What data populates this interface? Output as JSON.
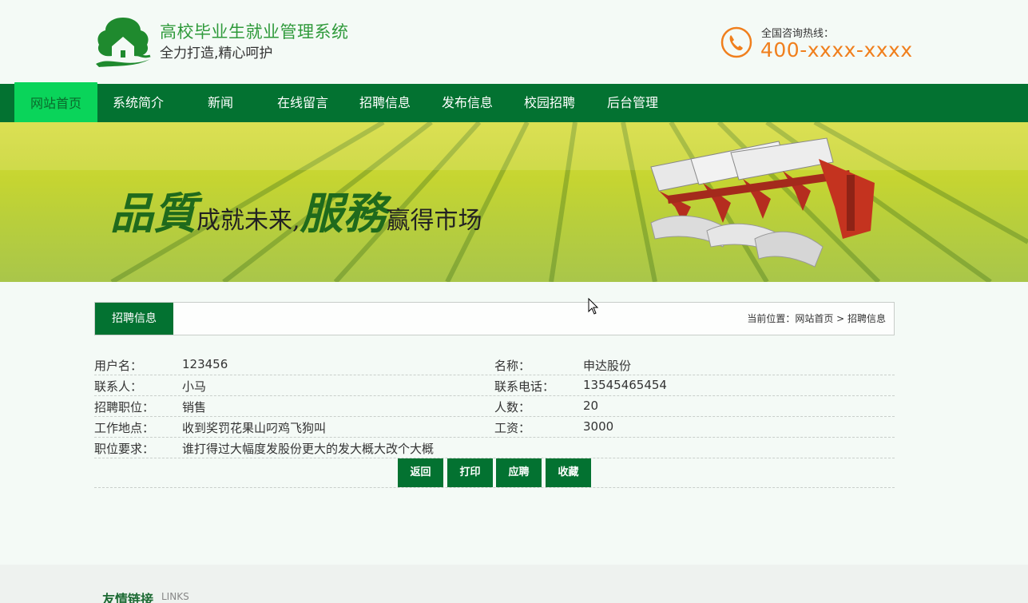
{
  "header": {
    "title": "高校毕业生就业管理系统",
    "slogan": "全力打造,精心呵护",
    "hotline_label": "全国咨询热线：",
    "hotline_number": "400-xxxx-xxxx"
  },
  "nav": {
    "items": [
      {
        "label": "网站首页"
      },
      {
        "label": "系统简介"
      },
      {
        "label": "新闻"
      },
      {
        "label": "在线留言"
      },
      {
        "label": "招聘信息"
      },
      {
        "label": "发布信息"
      },
      {
        "label": "校园招聘"
      },
      {
        "label": "后台管理"
      }
    ],
    "active_index": 0
  },
  "banner": {
    "text_big_1": "品質",
    "text_small_1": "成就未来,",
    "text_big_2": "服務",
    "text_small_2": "赢得市场"
  },
  "section": {
    "tab_label": "招聘信息",
    "breadcrumb": "当前位置：网站首页 > 招聘信息"
  },
  "detail": {
    "rows": [
      {
        "label1": "用户名：",
        "value1": "123456",
        "label2": "名称：",
        "value2": "申达股份"
      },
      {
        "label1": "联系人：",
        "value1": "小马",
        "label2": "联系电话：",
        "value2": "13545465454"
      },
      {
        "label1": "招聘职位：",
        "value1": "销售",
        "label2": "人数：",
        "value2": "20"
      },
      {
        "label1": "工作地点：",
        "value1": "收到奖罚花果山叼鸡飞狗叫",
        "label2": "工资：",
        "value2": "3000"
      },
      {
        "label1": "职位要求：",
        "value1": "谁打得过大幅度发股份更大的发大概大改个大概",
        "label2": "",
        "value2": ""
      }
    ]
  },
  "actions": {
    "back": "返回",
    "print": "打印",
    "apply": "应聘",
    "favorite": "收藏"
  },
  "footer": {
    "links_title": "友情链接",
    "links_sub": "LINKS"
  },
  "colors": {
    "primary": "#037231",
    "active_nav": "#0ad45a",
    "hotline": "#f07f1d",
    "title": "#2f9a3b"
  }
}
